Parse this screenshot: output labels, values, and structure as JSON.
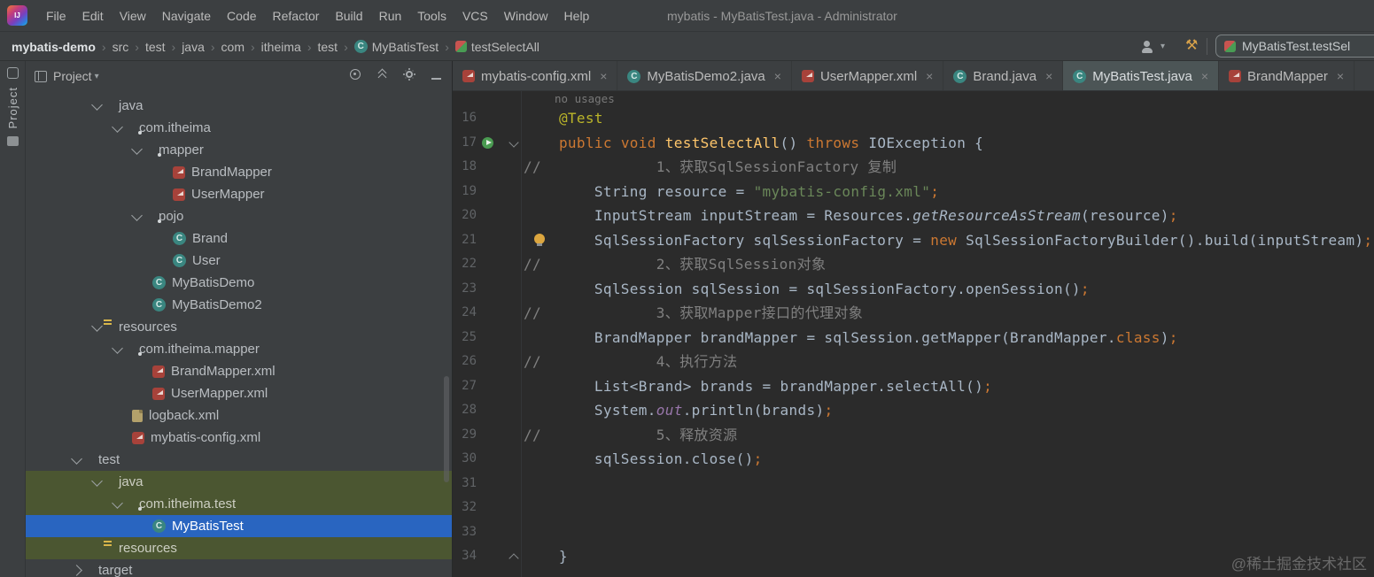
{
  "colors": {
    "panel_bg": "#3c3f41",
    "editor_bg": "#2b2b2b",
    "selection_blue": "#2965c0",
    "selection_olive": "#4b5631",
    "keyword_orange": "#cc7832",
    "string_green": "#6a8759",
    "comment_gray": "#808080",
    "method_yellow": "#ffc66b",
    "annotation_yellow": "#bbb529",
    "mybatis_red": "#a7423a",
    "class_teal": "#3a8680",
    "build_icon_yellow": "#d8a24a"
  },
  "titlebar": {
    "window_title": "mybatis - MyBatisTest.java - Administrator",
    "logo_text": "IJ",
    "menu_items": [
      "File",
      "Edit",
      "View",
      "Navigate",
      "Code",
      "Refactor",
      "Build",
      "Run",
      "Tools",
      "VCS",
      "Window",
      "Help"
    ]
  },
  "breadcrumbs": {
    "items": [
      {
        "label": "mybatis-demo",
        "bold": true
      },
      {
        "label": "src"
      },
      {
        "label": "test"
      },
      {
        "label": "java"
      },
      {
        "label": "com"
      },
      {
        "label": "itheima"
      },
      {
        "label": "test"
      },
      {
        "label": "MyBatisTest",
        "icon": "class"
      },
      {
        "label": "testSelectAll",
        "icon": "test-method"
      }
    ]
  },
  "navbar_right": {
    "user_icon": "user-profile",
    "build_icon": "build-hammer",
    "build_glyph": "⚒",
    "run_widget": {
      "icon": "test-method",
      "label": "MyBatisTest.testSel"
    }
  },
  "tool_strip": {
    "label": "Project"
  },
  "project_panel": {
    "title": "Project",
    "header_icons": [
      "locate",
      "collapse-all",
      "settings-gear",
      "hide"
    ],
    "tree": [
      {
        "label": "java",
        "icon": "folder-green",
        "pad": 76,
        "chev": "down",
        "hl": ""
      },
      {
        "label": "com.itheima",
        "icon": "package",
        "pad": 99,
        "chev": "down",
        "hl": ""
      },
      {
        "label": "mapper",
        "icon": "package",
        "pad": 121,
        "chev": "down",
        "hl": ""
      },
      {
        "label": "BrandMapper",
        "icon": "mybatis-mapper",
        "pad": 144,
        "chev": "",
        "hl": ""
      },
      {
        "label": "UserMapper",
        "icon": "mybatis-mapper",
        "pad": 144,
        "chev": "",
        "hl": ""
      },
      {
        "label": "pojo",
        "icon": "package",
        "pad": 121,
        "chev": "down",
        "hl": ""
      },
      {
        "label": "Brand",
        "icon": "class",
        "pad": 144,
        "chev": "",
        "hl": ""
      },
      {
        "label": "User",
        "icon": "class",
        "pad": 144,
        "chev": "",
        "hl": ""
      },
      {
        "label": "MyBatisDemo",
        "icon": "class",
        "pad": 121,
        "chev": "",
        "hl": ""
      },
      {
        "label": "MyBatisDemo2",
        "icon": "class",
        "pad": 121,
        "chev": "",
        "hl": ""
      },
      {
        "label": "resources",
        "icon": "folder-resources",
        "pad": 76,
        "chev": "down",
        "hl": ""
      },
      {
        "label": "com.itheima.mapper",
        "icon": "package",
        "pad": 99,
        "chev": "down",
        "hl": ""
      },
      {
        "label": "BrandMapper.xml",
        "icon": "mybatis-mapper",
        "pad": 121,
        "chev": "",
        "hl": ""
      },
      {
        "label": "UserMapper.xml",
        "icon": "mybatis-mapper",
        "pad": 121,
        "chev": "",
        "hl": ""
      },
      {
        "label": "logback.xml",
        "icon": "xml-file",
        "pad": 98,
        "chev": "",
        "hl": ""
      },
      {
        "label": "mybatis-config.xml",
        "icon": "mybatis-mapper",
        "pad": 98,
        "chev": "",
        "hl": ""
      },
      {
        "label": "test",
        "icon": "folder-gray",
        "pad": 53,
        "chev": "down",
        "hl": ""
      },
      {
        "label": "java",
        "icon": "folder-green",
        "pad": 76,
        "chev": "down",
        "hl": "olive"
      },
      {
        "label": "com.itheima.test",
        "icon": "package",
        "pad": 99,
        "chev": "down",
        "hl": "olive"
      },
      {
        "label": "MyBatisTest",
        "icon": "class",
        "pad": 121,
        "chev": "",
        "hl": "blue"
      },
      {
        "label": "resources",
        "icon": "folder-resources",
        "pad": 76,
        "chev": "",
        "hl": "olive"
      },
      {
        "label": "target",
        "icon": "folder-gray",
        "pad": 53,
        "chev": "right",
        "hl": ""
      }
    ]
  },
  "tabs": [
    {
      "label": "mybatis-config.xml",
      "icon": "mybatis-mapper",
      "active": false
    },
    {
      "label": "MyBatisDemo2.java",
      "icon": "class",
      "active": false
    },
    {
      "label": "UserMapper.xml",
      "icon": "mybatis-mapper",
      "active": false
    },
    {
      "label": "Brand.java",
      "icon": "class",
      "active": false
    },
    {
      "label": "MyBatisTest.java",
      "icon": "class",
      "active": true
    },
    {
      "label": "BrandMapper",
      "icon": "mybatis-mapper",
      "active": false
    }
  ],
  "editor": {
    "inlay_hint": "no usages",
    "lines": [
      {
        "n": 16,
        "segs": [
          {
            "t": "    "
          },
          {
            "t": "@Test",
            "c": "ann"
          }
        ]
      },
      {
        "n": 17,
        "gutter": [
          "run-test",
          "fold-down"
        ],
        "segs": [
          {
            "t": "    "
          },
          {
            "t": "public",
            "c": "kw"
          },
          {
            "t": " "
          },
          {
            "t": "void",
            "c": "kw"
          },
          {
            "t": " "
          },
          {
            "t": "testSelectAll",
            "c": "mth"
          },
          {
            "t": "() "
          },
          {
            "t": "throws",
            "c": "kw"
          },
          {
            "t": " IOException {"
          }
        ]
      },
      {
        "n": 18,
        "segs": [
          {
            "t": "//             1、获取SqlSessionFactory 复制",
            "c": "cmt"
          }
        ]
      },
      {
        "n": 19,
        "segs": [
          {
            "t": "        String resource = "
          },
          {
            "t": "\"mybatis-config.xml\"",
            "c": "str"
          },
          {
            "t": ";",
            "c": "kw"
          }
        ]
      },
      {
        "n": 20,
        "segs": [
          {
            "t": "        InputStream inputStream = Resources."
          },
          {
            "t": "getResourceAsStream",
            "c": "stm"
          },
          {
            "t": "(resource)"
          },
          {
            "t": ";",
            "c": "kw"
          }
        ]
      },
      {
        "n": 21,
        "bulb": true,
        "segs": [
          {
            "t": "        SqlSessionFactory sqlSessionFactory = "
          },
          {
            "t": "new",
            "c": "kw"
          },
          {
            "t": " SqlSessionFactoryBuilder().build(inputStream)"
          },
          {
            "t": ";",
            "c": "kw"
          }
        ]
      },
      {
        "n": 22,
        "segs": [
          {
            "t": "//             2、获取SqlSession对象",
            "c": "cmt"
          }
        ]
      },
      {
        "n": 23,
        "segs": [
          {
            "t": "        SqlSession sqlSession = sqlSessionFactory.openSession()"
          },
          {
            "t": ";",
            "c": "kw"
          }
        ]
      },
      {
        "n": 24,
        "segs": [
          {
            "t": "//             3、获取Mapper接口的代理对象",
            "c": "cmt"
          }
        ]
      },
      {
        "n": 25,
        "segs": [
          {
            "t": "        BrandMapper brandMapper = sqlSession.getMapper(BrandMapper."
          },
          {
            "t": "class",
            "c": "kw"
          },
          {
            "t": ")"
          },
          {
            "t": ";",
            "c": "kw"
          }
        ]
      },
      {
        "n": 26,
        "segs": [
          {
            "t": "//             4、执行方法",
            "c": "cmt"
          }
        ]
      },
      {
        "n": 27,
        "segs": [
          {
            "t": "        List<Brand> brands = brandMapper.selectAll()"
          },
          {
            "t": ";",
            "c": "kw"
          }
        ]
      },
      {
        "n": 28,
        "segs": [
          {
            "t": "        System."
          },
          {
            "t": "out",
            "c": "fld"
          },
          {
            "t": ".println(brands)"
          },
          {
            "t": ";",
            "c": "kw"
          }
        ]
      },
      {
        "n": 29,
        "segs": [
          {
            "t": "//             5、释放资源",
            "c": "cmt"
          }
        ]
      },
      {
        "n": 30,
        "segs": [
          {
            "t": "        sqlSession.close()"
          },
          {
            "t": ";",
            "c": "kw"
          }
        ]
      },
      {
        "n": 31,
        "segs": []
      },
      {
        "n": 32,
        "segs": []
      },
      {
        "n": 33,
        "segs": []
      },
      {
        "n": 34,
        "gutter": [
          "fold-up"
        ],
        "segs": [
          {
            "t": "    }"
          }
        ]
      }
    ]
  },
  "watermark": "@稀土掘金技术社区"
}
